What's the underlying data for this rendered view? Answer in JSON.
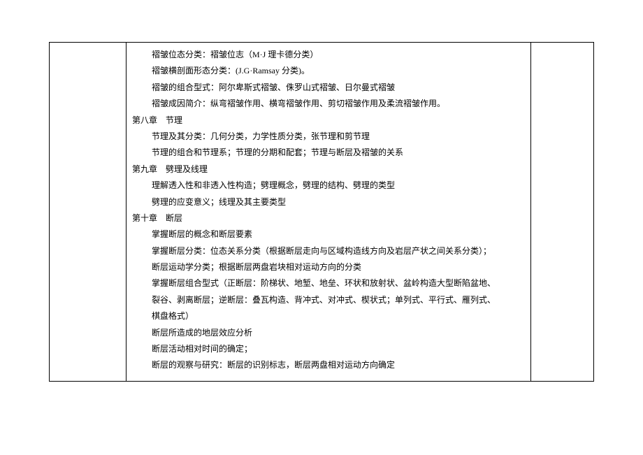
{
  "lines": [
    {
      "cls": "indent-1",
      "text": "褶皱位态分类：褶皱位志（M·J 理卡德分类）"
    },
    {
      "cls": "indent-1",
      "text": "褶皱横剖面形态分类：(J.G·Ramsay 分类)。"
    },
    {
      "cls": "indent-1",
      "text": "褶皱的组合型式：阿尔卑斯式褶皱、侏罗山式褶皱、日尔曼式褶皱"
    },
    {
      "cls": "indent-1",
      "text": "褶皱成因简介：纵弯褶皱作用、横弯褶皱作用、剪切褶皱作用及柔流褶皱作用。"
    },
    {
      "cls": "indent-2",
      "text": "第八章　节理"
    },
    {
      "cls": "indent-1",
      "text": "节理及其分类：几何分类，力学性质分类，张节理和剪节理"
    },
    {
      "cls": "indent-1",
      "text": "节理的组合和节理系；节理的分期和配套；节理与断层及褶皱的关系"
    },
    {
      "cls": "indent-2",
      "text": "第九章　劈理及线理"
    },
    {
      "cls": "indent-1",
      "text": "理解透入性和非透入性构造；劈理概念，劈理的结构、劈理的类型"
    },
    {
      "cls": "indent-1",
      "text": "劈理的应变意义；线理及其主要类型"
    },
    {
      "cls": "indent-2",
      "text": "第十章　断层"
    },
    {
      "cls": "indent-1",
      "text": "掌握断层的概念和断层要素"
    },
    {
      "cls": "indent-1",
      "text": "掌握断层分类：位态关系分类（根据断层走向与区域构造线方向及岩层产状之间关系分类）；"
    },
    {
      "cls": "indent-1",
      "text": "断层运动学分类；根据断层两盘岩块相对运动方向的分类"
    },
    {
      "cls": "indent-1",
      "text": "掌握断层组合型式（正断层：阶梯状、地堑、地垒、环状和放射状、盆岭构造大型断陷盆地、"
    },
    {
      "cls": "indent-1",
      "text": "裂谷、剥离断层；逆断层：叠瓦构造、背冲式、对冲式、楔状式；单列式、平行式、雁列式、"
    },
    {
      "cls": "indent-1",
      "text": "棋盘格式）"
    },
    {
      "cls": "indent-1",
      "text": "断层所造成的地层效应分析"
    },
    {
      "cls": "indent-1",
      "text": "断层活动相对时间的确定；"
    },
    {
      "cls": "indent-1",
      "text": "断层的观察与研究：断层的识别标志，断层两盘相对运动方向确定"
    }
  ]
}
